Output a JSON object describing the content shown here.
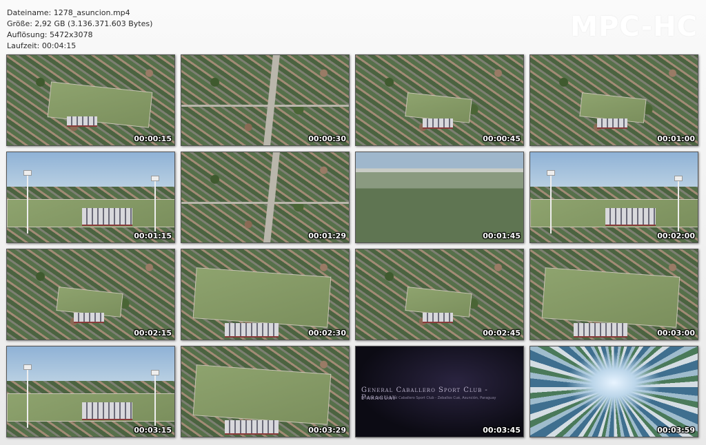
{
  "header": {
    "filename": "Dateiname: 1278_asuncion.mp4",
    "size": "Größe: 2,92 GB (3.136.371.603 Bytes)",
    "resolution": "Auflösung: 5472x3078",
    "duration": "Laufzeit: 00:04:15"
  },
  "brand": "MPC-HC",
  "thumbnails": [
    {
      "time": "00:00:15",
      "scene": "stadium-aerial"
    },
    {
      "time": "00:00:30",
      "scene": "city-street"
    },
    {
      "time": "00:00:45",
      "scene": "stadium-far"
    },
    {
      "time": "00:01:00",
      "scene": "stadium-far"
    },
    {
      "time": "00:01:15",
      "scene": "stadium-sky"
    },
    {
      "time": "00:01:29",
      "scene": "city-street"
    },
    {
      "time": "00:01:45",
      "scene": "river-city"
    },
    {
      "time": "00:02:00",
      "scene": "stadium-sky"
    },
    {
      "time": "00:02:15",
      "scene": "stadium-far"
    },
    {
      "time": "00:02:30",
      "scene": "field-close"
    },
    {
      "time": "00:02:45",
      "scene": "stadium-far"
    },
    {
      "time": "00:03:00",
      "scene": "field-close"
    },
    {
      "time": "00:03:15",
      "scene": "stadium-sky"
    },
    {
      "time": "00:03:29",
      "scene": "field-close"
    },
    {
      "time": "00:03:45",
      "scene": "title-card"
    },
    {
      "time": "00:03:59",
      "scene": "motion-blur"
    }
  ],
  "title_card": {
    "title": "General Caballero Sport Club - Paraguay",
    "subtitle": "Estadio Club General Caballero Sport Club - Zeballos Cué, Asunción, Paraguay"
  }
}
